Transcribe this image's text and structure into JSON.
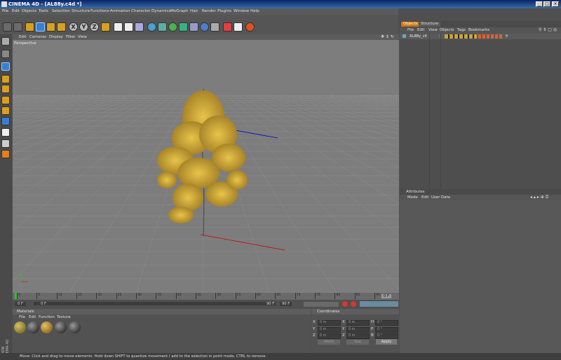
{
  "window": {
    "title": "CINEMA 4D - [AL88y.c4d *]"
  },
  "menubar": [
    "File",
    "Edit",
    "Objects",
    "Tools",
    "Selection",
    "Structure",
    "Functions",
    "Animation",
    "Character",
    "Dynamics",
    "MoGraph",
    "Hair",
    "Render",
    "Plugins",
    "Window",
    "Help"
  ],
  "toolbar": {
    "axis_x": "X",
    "axis_y": "Y",
    "axis_z": "Z"
  },
  "viewport": {
    "menu": [
      "Edit",
      "Cameras",
      "Display",
      "Filter",
      "View"
    ],
    "label": "Perspective"
  },
  "timeline": {
    "ticks": [
      "0",
      "5",
      "10",
      "15",
      "20",
      "25",
      "30",
      "35",
      "40",
      "45",
      "50",
      "55",
      "60",
      "65",
      "70",
      "75",
      "80",
      "85",
      "90"
    ],
    "current_frame": "0 F",
    "frame_start": "0 F",
    "frame_display": "0 F",
    "frame_end": "90 F",
    "frame_end2": "90 F"
  },
  "materials": {
    "title": "Materials",
    "menu": [
      "File",
      "Edit",
      "Function",
      "Texture"
    ],
    "swatch_count": 5
  },
  "coordinates": {
    "title": "Coordinates",
    "rows": [
      {
        "a": "X",
        "av": "0 m",
        "b": "X",
        "bv": "0 m",
        "c": "H",
        "cv": "0 °"
      },
      {
        "a": "Y",
        "av": "0 m",
        "b": "Y",
        "bv": "0 m",
        "c": "P",
        "cv": "0 °"
      },
      {
        "a": "Z",
        "av": "0 m",
        "b": "Z",
        "bv": "0 m",
        "c": "B",
        "cv": "0 °"
      }
    ],
    "mode1": "World",
    "mode2": "Size",
    "apply": "Apply"
  },
  "objects_panel": {
    "tabs": [
      "Objects",
      "Structure"
    ],
    "menu": [
      "File",
      "Edit",
      "View",
      "Objects",
      "Tags",
      "Bookmarks"
    ],
    "item": "AL88y_clt"
  },
  "attributes_panel": {
    "title": "Attributes",
    "menu": [
      "Mode",
      "Edit",
      "User Data"
    ]
  },
  "statusbar": {
    "text": "Move: Click and drag to move elements. Hold down SHIFT to quantize movement / add to the selection in point mode, CTRL to remove."
  },
  "side_logo": "MAXON CINEMA 4D",
  "colors": {
    "accent_orange": "#e58a1f",
    "leaf_gold": "#c9a53a",
    "viewport_bg": "#7d7d7d"
  }
}
